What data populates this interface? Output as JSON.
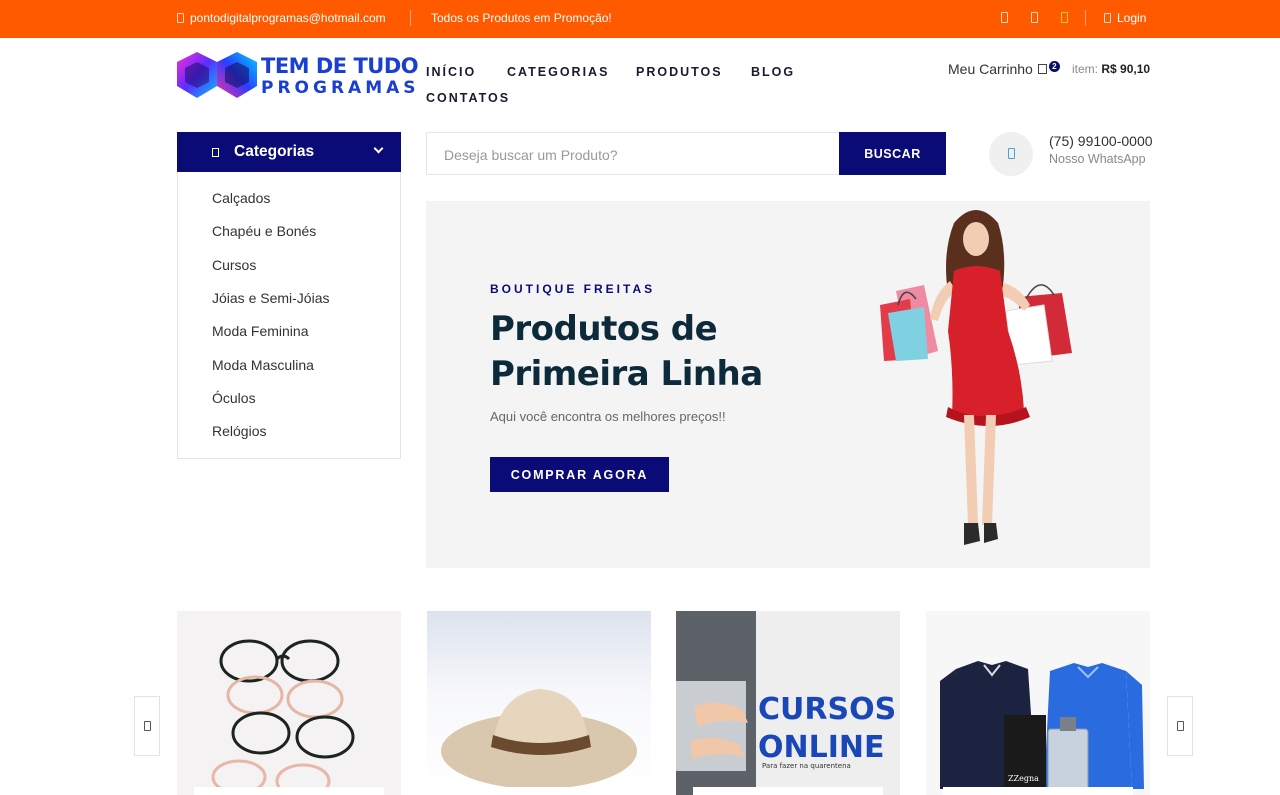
{
  "topbar": {
    "email": "pontodigitalprogramas@hotmail.com",
    "promo": "Todos os Produtos em Promoção!",
    "login": "Login"
  },
  "logo": {
    "line1": "TEM DE TUDO",
    "line2": "PROGRAMAS"
  },
  "nav": {
    "items": [
      "INÍCIO",
      "CATEGORIAS",
      "PRODUTOS",
      "BLOG",
      "CONTATOS"
    ]
  },
  "cart": {
    "label": "Meu Carrinho",
    "count": "2",
    "item_label": "item:",
    "total": "R$ 90,10"
  },
  "categories": {
    "title": "Categorias",
    "items": [
      "Calçados",
      "Chapéu e Bonés",
      "Cursos",
      "Jóias e Semi-Jóias",
      "Moda Feminina",
      "Moda Masculina",
      "Óculos",
      "Relógios"
    ]
  },
  "search": {
    "placeholder": "Deseja buscar um Produto?",
    "button": "BUSCAR"
  },
  "whatsapp": {
    "phone": "(75) 99100-0000",
    "label": "Nosso WhatsApp"
  },
  "hero": {
    "subtitle": "BOUTIQUE FREITAS",
    "title_line1": "Produtos de",
    "title_line2": "Primeira Linha",
    "description": "Aqui você encontra os melhores preços!!",
    "cta": "COMPRAR AGORA"
  },
  "products": {
    "course_word1": "CURSOS",
    "course_word2": "ONLINE",
    "course_tagline": "Para fazer na quarentena",
    "perfume_brand": "ZZegna"
  },
  "colors": {
    "topbar": "#ff5a00",
    "primary": "#0b0b78",
    "logo_text": "#1a3fd1",
    "hero_title": "#0d2a3a"
  }
}
